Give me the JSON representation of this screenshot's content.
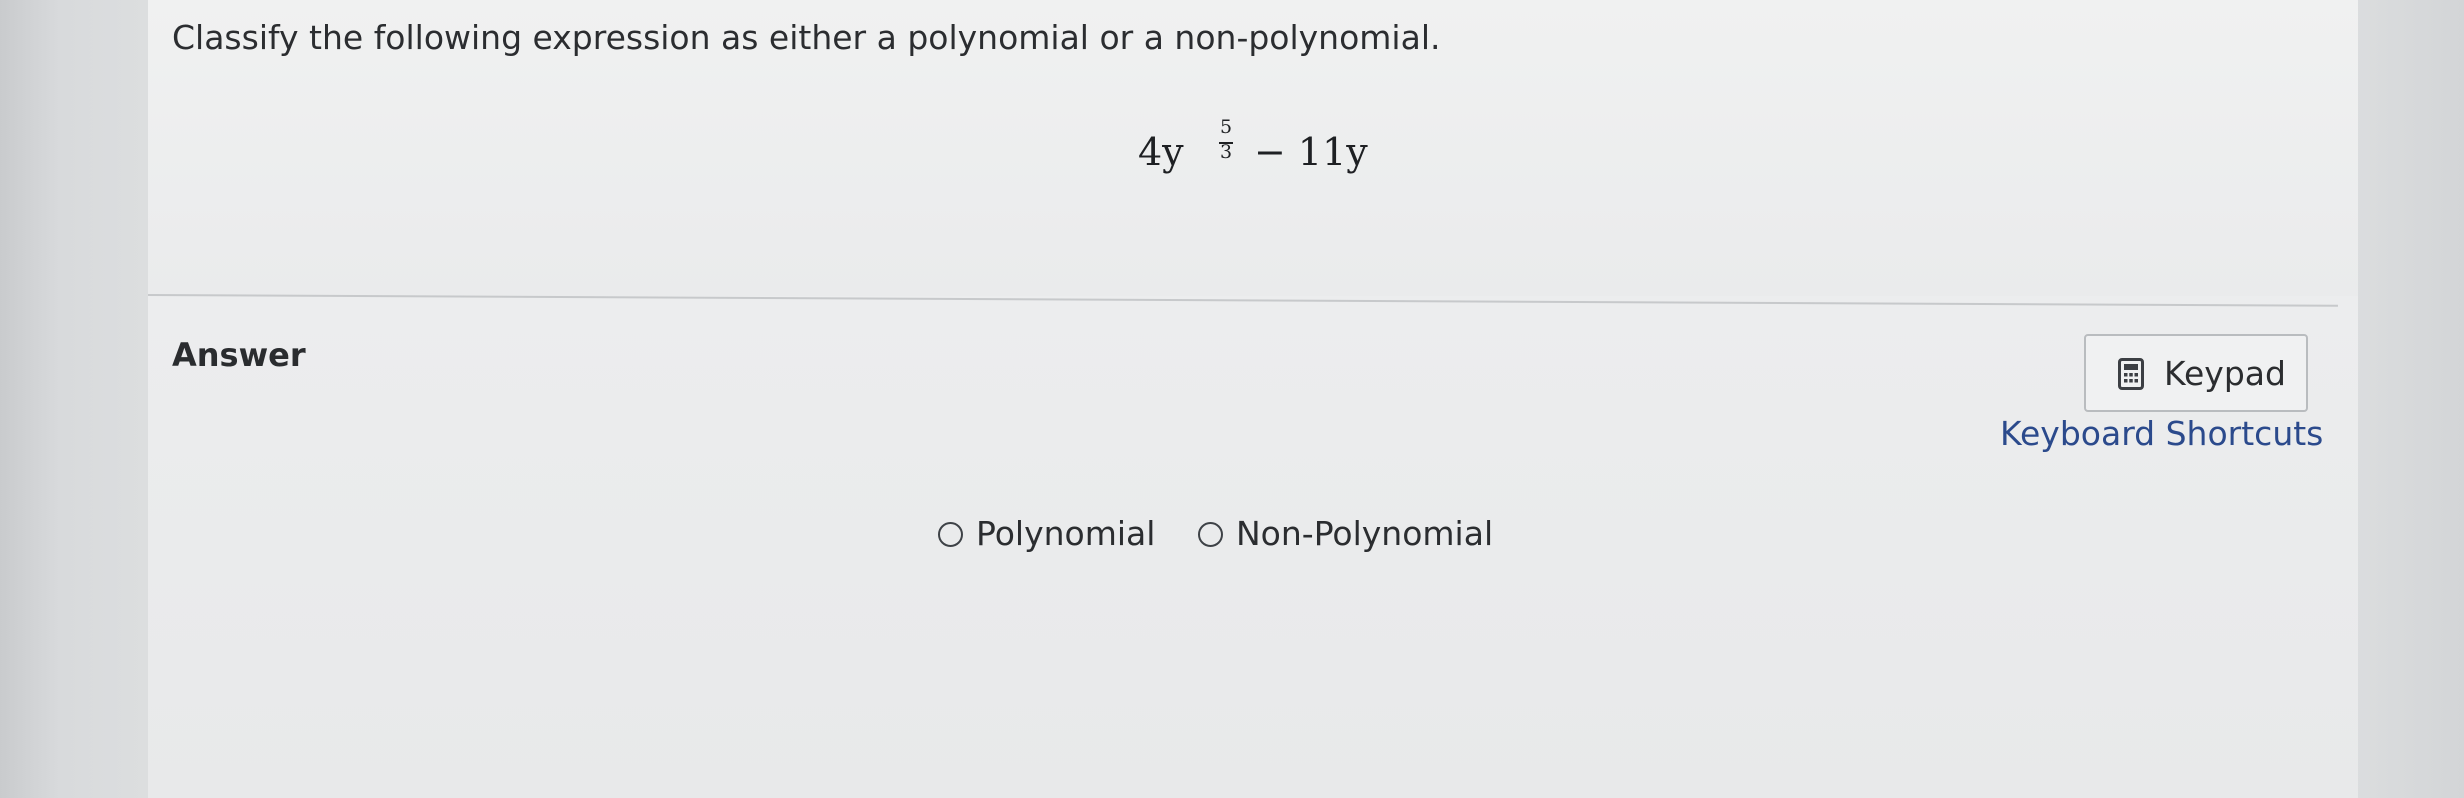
{
  "question": {
    "text": "Classify the following expression as either a polynomial or a non-polynomial.",
    "expression": {
      "coefficient_term": "4y",
      "exponent_numerator": "5",
      "exponent_denominator": "3",
      "rest": "− 11y"
    }
  },
  "answer": {
    "label": "Answer",
    "options": [
      {
        "label": "Polynomial",
        "selected": false
      },
      {
        "label": "Non-Polynomial",
        "selected": false
      }
    ]
  },
  "tools": {
    "keypad_label": "Keypad",
    "keypad_icon": "calculator-icon",
    "shortcuts_label": "Keyboard Shortcuts"
  },
  "colors": {
    "link": "#2b4a8c",
    "text": "#2b2d30"
  }
}
